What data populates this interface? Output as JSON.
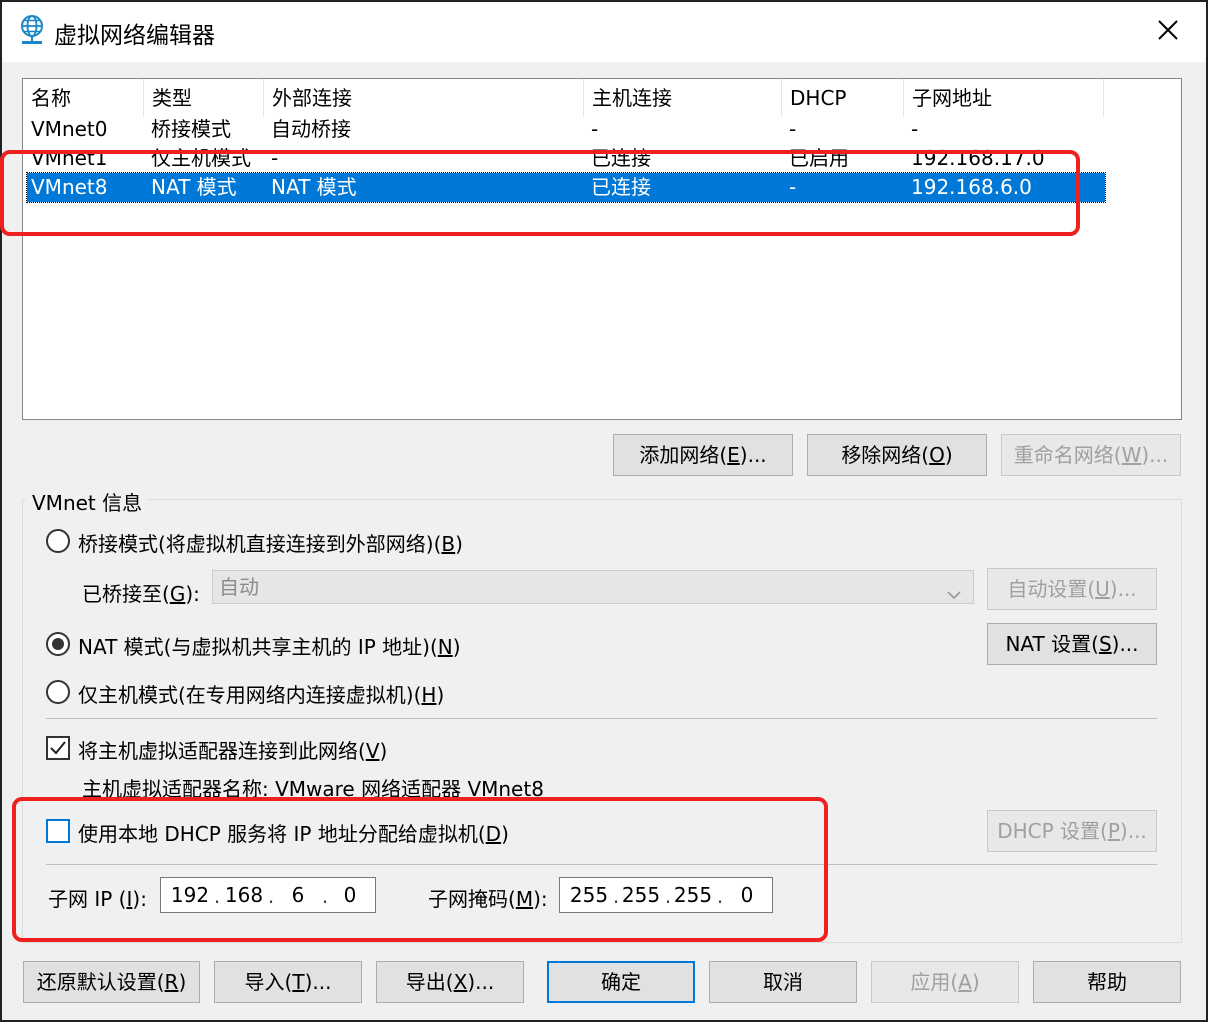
{
  "window": {
    "title": "虚拟网络编辑器",
    "icon": "globe-network-icon",
    "close_icon": "close-icon"
  },
  "list": {
    "columns": [
      "名称",
      "类型",
      "外部连接",
      "主机连接",
      "DHCP",
      "子网地址"
    ],
    "rows": [
      [
        "VMnet0",
        "桥接模式",
        "自动桥接",
        "-",
        "-",
        "-"
      ],
      [
        "VMnet1",
        "仅主机模式",
        "-",
        "已连接",
        "已启用",
        "192.168.17.0"
      ],
      [
        "VMnet8",
        "NAT 模式",
        "NAT 模式",
        "已连接",
        "-",
        "192.168.6.0"
      ]
    ],
    "selected_row": "VMnet8"
  },
  "list_buttons": {
    "add_pre": "添加网络(",
    "add_key": "E",
    "add_post": ")...",
    "remove_pre": "移除网络(",
    "remove_key": "O",
    "remove_post": ")",
    "rename_pre": "重命名网络(",
    "rename_key": "W",
    "rename_post": ")..."
  },
  "vmnet_info": {
    "group_label": "VMnet 信息",
    "bridged_pre": "桥接模式(将虚拟机直接连接到外部网络)(",
    "bridged_key": "B",
    "bridged_post": ")",
    "bridged_to_pre": "已桥接至(",
    "bridged_to_key": "G",
    "bridged_to_post": "):",
    "bridged_to_value": "自动",
    "auto_settings_pre": "自动设置(",
    "auto_settings_key": "U",
    "auto_settings_post": ")...",
    "nat_pre": "NAT 模式(与虚拟机共享主机的 IP 地址)(",
    "nat_key": "N",
    "nat_post": ")",
    "nat_settings_pre": "NAT 设置(",
    "nat_settings_key": "S",
    "nat_settings_post": ")...",
    "hostonly_pre": "仅主机模式(在专用网络内连接虚拟机)(",
    "hostonly_key": "H",
    "hostonly_post": ")",
    "selected_mode": "NAT",
    "connect_adapter_pre": "将主机虚拟适配器连接到此网络(",
    "connect_adapter_key": "V",
    "connect_adapter_post": ")",
    "connect_adapter_checked": true,
    "adapter_name": "主机虚拟适配器名称: VMware 网络适配器 VMnet8",
    "dhcp_pre": "使用本地 DHCP 服务将 IP 地址分配给虚拟机(",
    "dhcp_key": "D",
    "dhcp_post": ")",
    "dhcp_checked": false,
    "dhcp_settings_pre": "DHCP 设置(",
    "dhcp_settings_key": "P",
    "dhcp_settings_post": ")...",
    "subnet_ip_pre": "子网 IP (",
    "subnet_ip_key": "I",
    "subnet_ip_post": "):",
    "subnet_ip": [
      "192",
      "168",
      "6",
      "0"
    ],
    "subnet_mask_pre": "子网掩码(",
    "subnet_mask_key": "M",
    "subnet_mask_post": "):",
    "subnet_mask": [
      "255",
      "255",
      "255",
      "0"
    ]
  },
  "footer": {
    "restore_pre": "还原默认设置(",
    "restore_key": "R",
    "restore_post": ")",
    "import_pre": "导入(",
    "import_key": "T",
    "import_post": ")...",
    "export_pre": "导出(",
    "export_key": "X",
    "export_post": ")...",
    "ok": "确定",
    "cancel": "取消",
    "apply_pre": "应用(",
    "apply_key": "A",
    "apply_post": ")",
    "help": "帮助"
  },
  "colors": {
    "selection": "#0078d7",
    "highlight_box": "#ee2020",
    "disabled_text": "#a0a0a0"
  }
}
